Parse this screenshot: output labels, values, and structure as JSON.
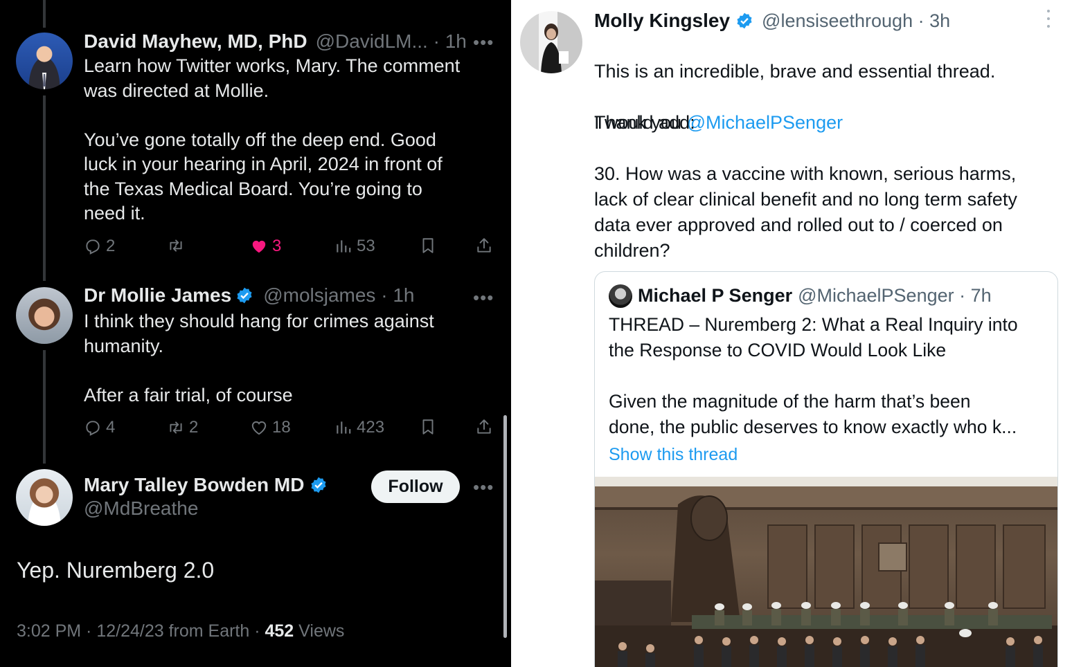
{
  "left_panel": {
    "tweets": [
      {
        "name": "David Mayhew, MD, PhD",
        "handle_time": "@DavidLM... · 1h",
        "text": "Learn how Twitter works, Mary. The comment\nwas directed at Mollie.\n\nYou’ve gone totally off the deep end. Good\nluck in your hearing in April, 2024 in front of\nthe Texas Medical Board. You’re going to\nneed it.",
        "replies": "2",
        "retweets": "",
        "likes": "3",
        "views": "53",
        "liked": true
      },
      {
        "name": "Dr Mollie James",
        "handle_time": "@molsjames · 1h",
        "text": "I think they should hang for crimes against\nhumanity.\n\nAfter a fair trial, of course",
        "replies": "4",
        "retweets": "2",
        "likes": "18",
        "views": "423",
        "liked": false
      }
    ],
    "main_tweet": {
      "name": "Mary Talley Bowden MD",
      "handle": "@MdBreathe",
      "follow_label": "Follow",
      "text": "Yep. Nuremberg 2.0",
      "meta_time": "3:02 PM · 12/24/23 from Earth · ",
      "views_count": "452",
      "views_label": " Views"
    },
    "icons": [
      "reply-icon",
      "retweet-icon",
      "like-icon",
      "views-icon",
      "bookmark-icon",
      "share-icon",
      "more-icon",
      "verified-badge-icon"
    ]
  },
  "right_panel": {
    "tweet": {
      "name": "Molly Kingsley",
      "handle_time": "@lensiseethrough · 3h",
      "text_line1": "This is an incredible, brave and essential thread.",
      "text_thank": "Thank you ",
      "mention": "@MichaelPSenger",
      "text_rest": "I would add:\n\n30. How was a vaccine with known, serious harms,\nlack of clear clinical benefit and no long term safety\ndata ever approved and rolled out to / coerced on\nchildren?"
    },
    "quote": {
      "name": "Michael P Senger",
      "handle_time": "@MichaelPSenger · 7h",
      "text": "THREAD – Nuremberg 2: What a Real Inquiry into\nthe Response to COVID Would Look Like\n\nGiven the magnitude of the harm that’s been\ndone, the public deserves to know exactly who k...",
      "show_thread": "Show this thread"
    }
  },
  "colors": {
    "accent": "#1d9bf0",
    "like_pink": "#f91880",
    "dark_bg": "#000000",
    "muted": "#71767b"
  }
}
